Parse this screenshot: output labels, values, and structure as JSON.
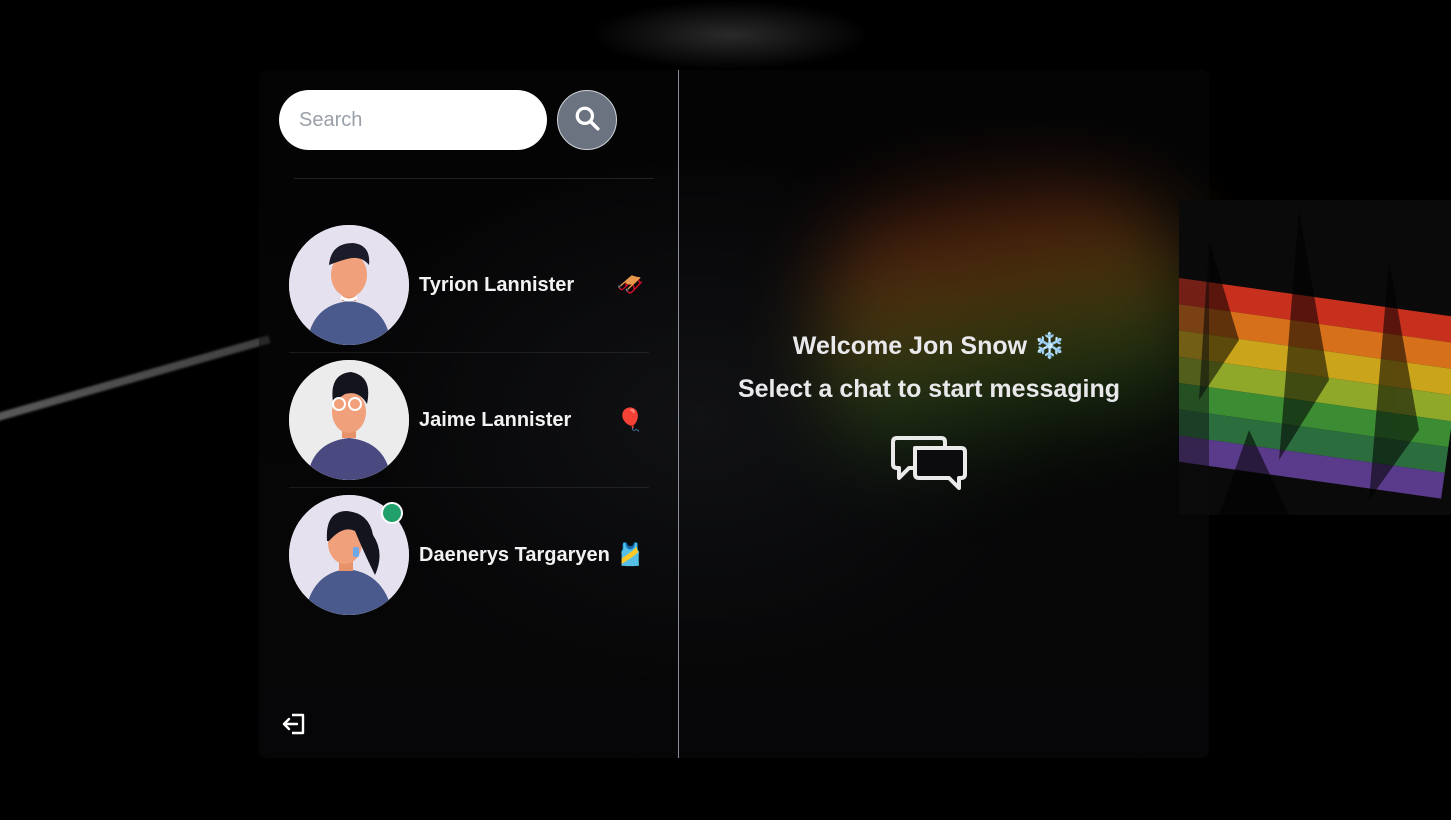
{
  "search": {
    "placeholder": "Search"
  },
  "chats": [
    {
      "name": "Tyrion Lannister",
      "emoji": "🛷",
      "online": false
    },
    {
      "name": "Jaime Lannister",
      "emoji": "🎈",
      "online": false
    },
    {
      "name": "Daenerys Targaryen",
      "emoji": "🎽",
      "online": true
    }
  ],
  "welcome": {
    "greeting": "Welcome Jon Snow ❄️",
    "subtitle": "Select a chat to start messaging"
  },
  "colors": {
    "accent_button": "#6b7280",
    "online": "#22a06b",
    "divider": "#8a8f9a"
  },
  "icons": {
    "search": "search-icon",
    "logout": "logout-icon",
    "chat": "chat-bubbles-icon"
  }
}
